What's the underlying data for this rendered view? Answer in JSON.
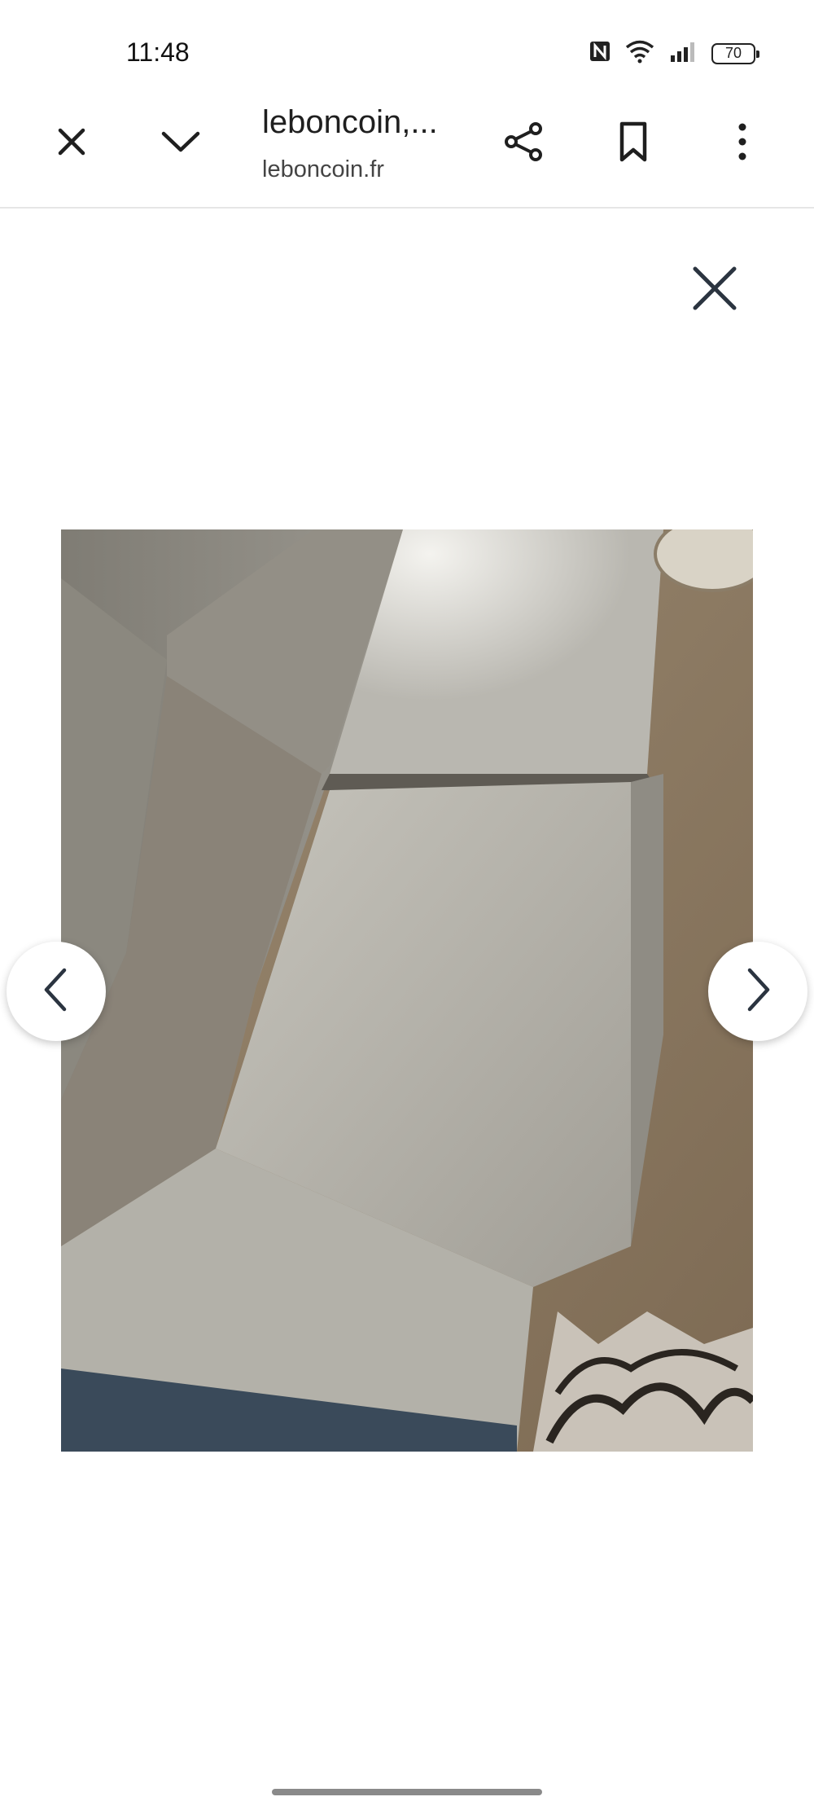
{
  "status_bar": {
    "time": "11:48",
    "battery": "70",
    "icons": [
      "nfc-icon",
      "wifi-icon",
      "signal-icon",
      "battery-icon"
    ]
  },
  "toolbar": {
    "page_title": "leboncoin,...",
    "page_domain": "leboncoin.fr",
    "icons": [
      "close-icon",
      "chevron-down-icon",
      "share-icon",
      "bookmark-icon",
      "more-vert-icon"
    ]
  },
  "viewer": {
    "icons": [
      "close-icon",
      "chevron-left-icon",
      "chevron-right-icon"
    ],
    "photo_subject": "sofa"
  },
  "colors": {
    "icon": "#1f1f1f",
    "viewer_icon": "#2b3440",
    "divider": "#e6e6e6"
  }
}
